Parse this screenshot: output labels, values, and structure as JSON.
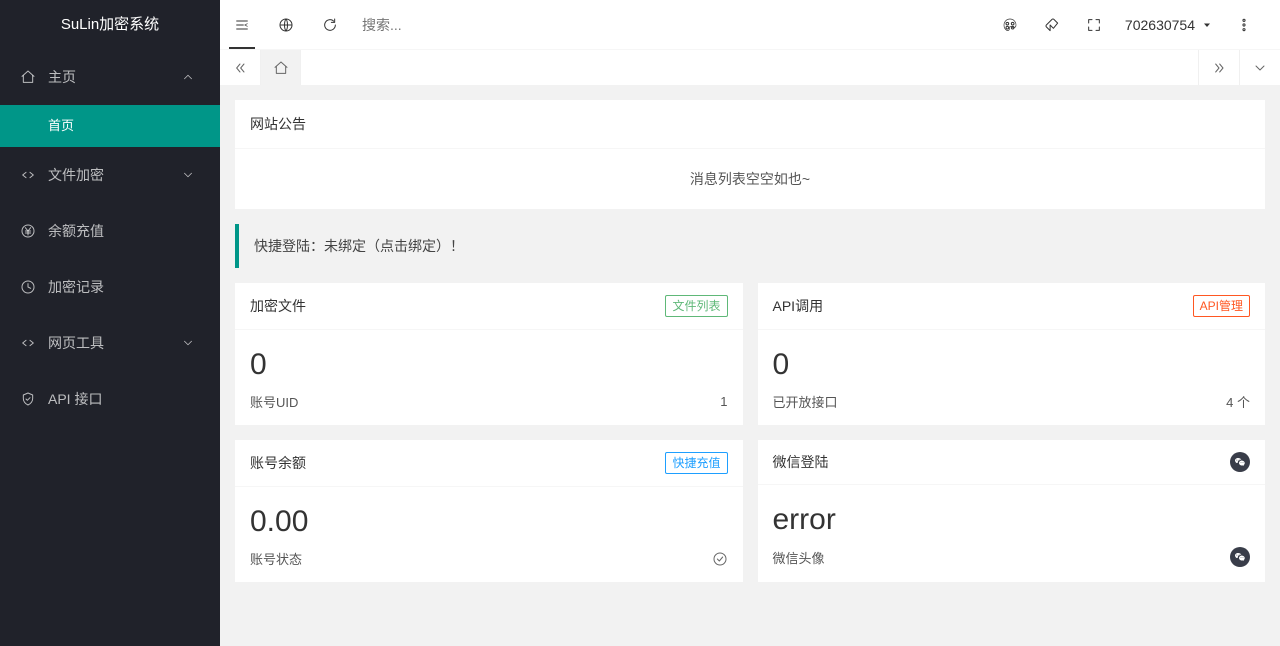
{
  "app": {
    "title": "SuLin加密系统"
  },
  "sidebar": {
    "items": [
      {
        "label": "主页",
        "icon": "home",
        "expandable": true,
        "expanded": true,
        "children": [
          {
            "label": "首页",
            "active": true
          }
        ]
      },
      {
        "label": "文件加密",
        "icon": "code",
        "expandable": true,
        "expanded": false
      },
      {
        "label": "余额充值",
        "icon": "yen"
      },
      {
        "label": "加密记录",
        "icon": "clock"
      },
      {
        "label": "网页工具",
        "icon": "code",
        "expandable": true,
        "expanded": false
      },
      {
        "label": "API 接口",
        "icon": "shield"
      }
    ]
  },
  "topbar": {
    "search_placeholder": "搜索...",
    "username": "702630754"
  },
  "announce": {
    "title": "网站公告",
    "empty_text": "消息列表空空如也~"
  },
  "quick_login": {
    "prefix": "快捷登陆：",
    "status": "未绑定（点击绑定）！"
  },
  "cards": {
    "encrypt": {
      "title": "加密文件",
      "badge": "文件列表",
      "value": "0",
      "footer_label": "账号UID",
      "footer_value": "1"
    },
    "api": {
      "title": "API调用",
      "badge": "API管理",
      "value": "0",
      "footer_label": "已开放接口",
      "footer_value": "4 个"
    },
    "balance": {
      "title": "账号余额",
      "badge": "快捷充值",
      "value": "0.00",
      "footer_label": "账号状态"
    },
    "wechat": {
      "title": "微信登陆",
      "value": "error",
      "footer_label": "微信头像"
    }
  }
}
